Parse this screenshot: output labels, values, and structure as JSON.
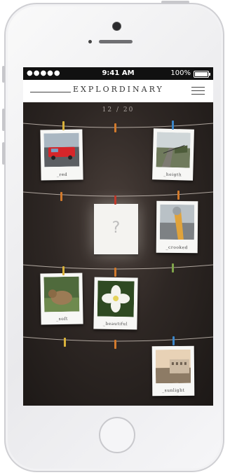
{
  "status": {
    "signal": "●●●●● ",
    "time": "9:41 AM",
    "battery": "100%",
    "battery_level": 1.0
  },
  "header": {
    "title": "EXPLORDINARY"
  },
  "counter": "12 / 20",
  "cards": [
    {
      "caption": "_red",
      "icon": "red-bus-photo"
    },
    {
      "caption": "_heigth",
      "icon": "stairs-photo"
    },
    {
      "caption": "_crooked",
      "icon": "pole-photo"
    },
    {
      "caption": "_soft",
      "icon": "dog-photo"
    },
    {
      "caption": "_beautiful",
      "icon": "flower-photo"
    },
    {
      "caption": "_sunlight",
      "icon": "building-photo"
    }
  ],
  "mystery": {
    "symbol": "?"
  },
  "colors": {
    "screen": "#1f1a18",
    "card": "#f7f7f5",
    "peg_yellow": "#d9b23b",
    "peg_blue": "#3b86c9",
    "peg_orange": "#d27a2c",
    "peg_red": "#c0392b",
    "peg_green": "#7fa34a"
  }
}
